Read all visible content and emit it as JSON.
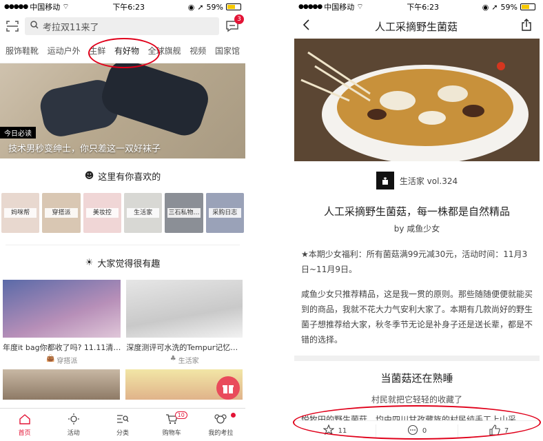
{
  "colors": {
    "accent": "#e31436",
    "annotation": "#e0001a"
  },
  "left": {
    "status": {
      "carrier": "中国移动",
      "time": "下午6:23",
      "battery": "59%"
    },
    "search": {
      "placeholder": "考拉双11来了",
      "message_badge": "3"
    },
    "categories": [
      "服饰鞋靴",
      "运动户外",
      "生鲜",
      "有好物",
      "全球旗舰",
      "视频",
      "国家馆"
    ],
    "active_category": "有好物",
    "banner": {
      "tag": "今日必读",
      "title": "技术男秒变绅士，你只差这一双好袜子"
    },
    "section1": {
      "title": "这里有你喜欢的",
      "icon": "ghost-icon"
    },
    "thumbs": [
      "妈咪帮",
      "穿搭派",
      "美妆控",
      "生活家",
      "三石私物…",
      "采购日志"
    ],
    "section2": {
      "title": "大家觉得很有趣",
      "icon": "bulb-icon"
    },
    "cards": [
      {
        "title": "年度it bag你都收了吗? 11.11清…",
        "source": "穿搭派",
        "source_icon": "bag-icon"
      },
      {
        "title": "深度测评可水洗的Tempur记忆…",
        "source": "生活家",
        "source_icon": "plant-icon"
      }
    ],
    "tabbar": [
      {
        "label": "首页",
        "icon": "home-icon",
        "active": true
      },
      {
        "label": "活动",
        "icon": "sun-icon"
      },
      {
        "label": "分类",
        "icon": "category-search-icon"
      },
      {
        "label": "购物车",
        "icon": "cart-icon",
        "badge": "10"
      },
      {
        "label": "我的考拉",
        "icon": "koala-icon",
        "dot": true
      }
    ]
  },
  "right": {
    "status": {
      "carrier": "中国移动",
      "time": "下午6:23",
      "battery": "59%"
    },
    "nav": {
      "title": "人工采摘野生菌菇"
    },
    "brand": {
      "name": "生活家 vol.324"
    },
    "article": {
      "title": "人工采摘野生菌菇，每一株都是自然精品",
      "author": "by 咸鱼少女",
      "p1": "★本期少女福利：所有菌菇满99元减30元，活动时间：11月3日~11月9日。",
      "p2": "咸鱼少女只推荐精品，这是我一贯的原则。那些随随便便就能买到的商品，我就不花大力气安利大家了。本期有几款尚好的野生菌子想推荐给大家，秋冬季节无论是补身子还是送长辈，都是不错的选择。",
      "subtitle": "当菌菇还在熟睡",
      "subsub": "村民就把它轻轻的收藏了",
      "p3": "悦牧田的野生菌菇，均由四川甘孜藏族的村民纯手工上山采"
    },
    "actions": [
      {
        "icon": "star-icon",
        "count": "11"
      },
      {
        "icon": "comment-icon",
        "count": "0"
      },
      {
        "icon": "thumbs-up-icon",
        "count": "7"
      }
    ]
  }
}
